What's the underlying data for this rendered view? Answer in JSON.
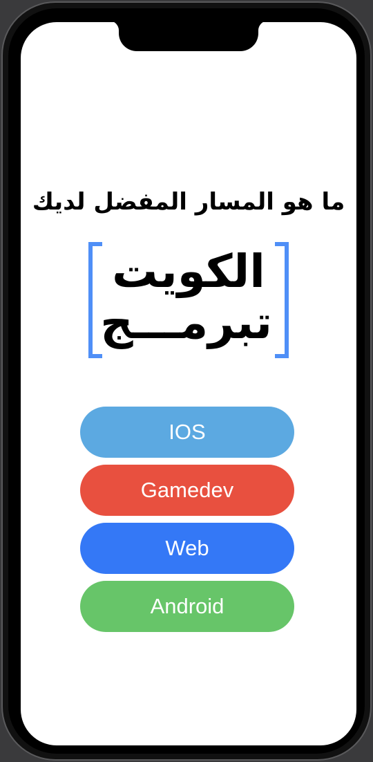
{
  "screen": {
    "title": "ما هو المسار المفضل لديك",
    "logo": {
      "line1": "الكويت",
      "line2": "تبرمـــج"
    },
    "buttons": [
      {
        "label": "IOS",
        "color": "#5ca9e1"
      },
      {
        "label": "Gamedev",
        "color": "#e8503f"
      },
      {
        "label": "Web",
        "color": "#3478f6"
      },
      {
        "label": "Android",
        "color": "#67c569"
      }
    ]
  },
  "colors": {
    "bracket": "#4f8ff7",
    "background": "#ffffff",
    "device_frame": "#111111"
  }
}
